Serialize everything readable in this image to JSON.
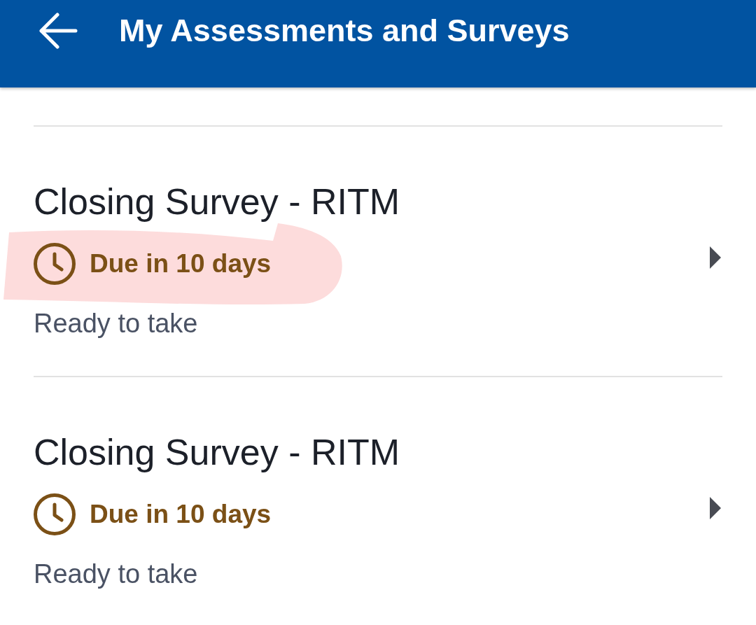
{
  "app_bar": {
    "title": "My Assessments and Surveys"
  },
  "surveys": [
    {
      "title": "Closing Survey - RITM",
      "due": "Due in 10 days",
      "status": "Ready to take",
      "highlighted": true
    },
    {
      "title": "Closing Survey - RITM",
      "due": "Due in 10 days",
      "status": "Ready to take",
      "highlighted": false
    }
  ]
}
